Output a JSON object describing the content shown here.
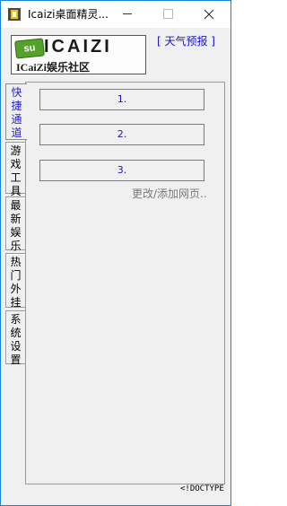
{
  "window": {
    "title": "Icaizi桌面精灵..."
  },
  "logo": {
    "badge": "su",
    "word": "ICAIZI",
    "subtitle": "ICaiZi娱乐社区"
  },
  "header": {
    "weather_link": "[ 天气预报 ]"
  },
  "tabs": [
    {
      "label_lines": [
        "快",
        "捷",
        "通",
        "道"
      ],
      "active": true
    },
    {
      "label_lines": [
        "游",
        "戏",
        "工",
        "具"
      ],
      "active": false
    },
    {
      "label_lines": [
        "最",
        "新",
        "娱",
        "乐"
      ],
      "active": false
    },
    {
      "label_lines": [
        "热",
        "门",
        "外",
        "挂"
      ],
      "active": false
    },
    {
      "label_lines": [
        "系",
        "统",
        "设",
        "置"
      ],
      "active": false
    }
  ],
  "shortcuts": [
    {
      "label": "1."
    },
    {
      "label": "2."
    },
    {
      "label": "3."
    }
  ],
  "edit_link": "更改/添加网页..",
  "status_text": "<!DOCTYPE",
  "colors": {
    "link_blue": "#1a12c8",
    "window_border": "#1883d7",
    "panel_bg": "#f0f0f0"
  }
}
